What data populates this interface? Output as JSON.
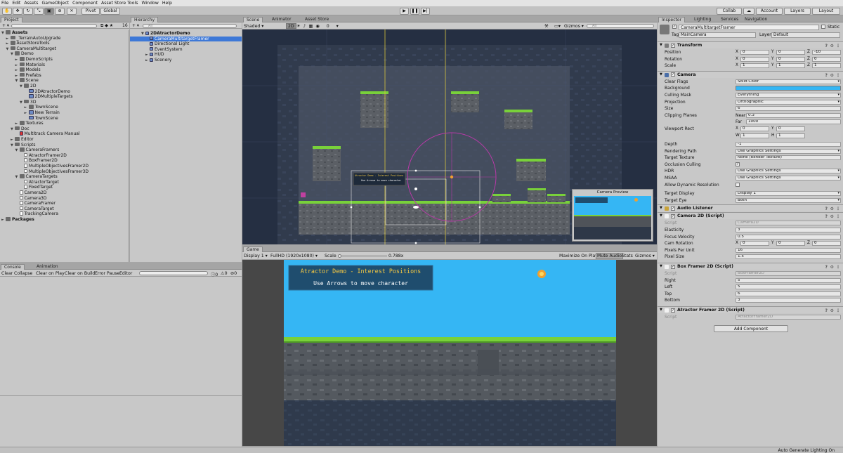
{
  "menu": [
    "File",
    "Edit",
    "Assets",
    "GameObject",
    "Component",
    "Asset Store Tools",
    "Window",
    "Help"
  ],
  "toolbar": {
    "pivot": "Pivot",
    "global": "Global",
    "collab": "Collab",
    "account": "Account",
    "layers": "Layers",
    "layout": "Layout"
  },
  "project": {
    "tabs": [
      "Project"
    ],
    "count": "16",
    "tree": [
      {
        "label": "Assets",
        "indent": 0,
        "arrow": "▼",
        "icon": "folder",
        "bold": true
      },
      {
        "label": "_TerrainAutoUpgrade",
        "indent": 1,
        "arrow": "►",
        "icon": "folder"
      },
      {
        "label": "AssetStoreTools",
        "indent": 1,
        "arrow": "►",
        "icon": "folder"
      },
      {
        "label": "CameraMultitarget",
        "indent": 1,
        "arrow": "▼",
        "icon": "folder"
      },
      {
        "label": "Demo",
        "indent": 2,
        "arrow": "▼",
        "icon": "folder"
      },
      {
        "label": "DemoScripts",
        "indent": 3,
        "arrow": "►",
        "icon": "folder"
      },
      {
        "label": "Materials",
        "indent": 3,
        "arrow": "►",
        "icon": "folder"
      },
      {
        "label": "Models",
        "indent": 3,
        "arrow": "►",
        "icon": "folder"
      },
      {
        "label": "Prefabs",
        "indent": 3,
        "arrow": "►",
        "icon": "folder"
      },
      {
        "label": "Scene",
        "indent": 3,
        "arrow": "▼",
        "icon": "folder"
      },
      {
        "label": "2D",
        "indent": 4,
        "arrow": "▼",
        "icon": "folder"
      },
      {
        "label": "2DAtractorDemo",
        "indent": 5,
        "arrow": "",
        "icon": "gameobj"
      },
      {
        "label": "2DMultipleTargets",
        "indent": 5,
        "arrow": "",
        "icon": "gameobj"
      },
      {
        "label": "3D",
        "indent": 4,
        "arrow": "▼",
        "icon": "folder"
      },
      {
        "label": "TownScene",
        "indent": 5,
        "arrow": "►",
        "icon": "folder"
      },
      {
        "label": "New Terrain",
        "indent": 5,
        "arrow": "►",
        "icon": "gameobj"
      },
      {
        "label": "TownScene",
        "indent": 5,
        "arrow": "",
        "icon": "gameobj"
      },
      {
        "label": "Textures",
        "indent": 3,
        "arrow": "►",
        "icon": "folder"
      },
      {
        "label": "Doc",
        "indent": 2,
        "arrow": "▼",
        "icon": "folder"
      },
      {
        "label": "Multitrack Camera Manual",
        "indent": 3,
        "arrow": "",
        "icon": "pdf"
      },
      {
        "label": "Editor",
        "indent": 2,
        "arrow": "►",
        "icon": "folder"
      },
      {
        "label": "Scripts",
        "indent": 2,
        "arrow": "▼",
        "icon": "folder"
      },
      {
        "label": "CameraFramers",
        "indent": 3,
        "arrow": "▼",
        "icon": "folder"
      },
      {
        "label": "AtractorFramer2D",
        "indent": 4,
        "arrow": "",
        "icon": "script"
      },
      {
        "label": "BoxFramer2D",
        "indent": 4,
        "arrow": "",
        "icon": "script"
      },
      {
        "label": "MultipleObjectivesFramer2D",
        "indent": 4,
        "arrow": "",
        "icon": "script"
      },
      {
        "label": "MultipleObjectivesFramer3D",
        "indent": 4,
        "arrow": "",
        "icon": "script"
      },
      {
        "label": "CameraTargets",
        "indent": 3,
        "arrow": "▼",
        "icon": "folder"
      },
      {
        "label": "AtractorTarget",
        "indent": 4,
        "arrow": "",
        "icon": "script"
      },
      {
        "label": "FixedTarget",
        "indent": 4,
        "arrow": "",
        "icon": "script"
      },
      {
        "label": "Camera2D",
        "indent": 3,
        "arrow": "",
        "icon": "script"
      },
      {
        "label": "Camera3D",
        "indent": 3,
        "arrow": "",
        "icon": "script"
      },
      {
        "label": "CameraFramer",
        "indent": 3,
        "arrow": "",
        "icon": "script"
      },
      {
        "label": "CameraTarget",
        "indent": 3,
        "arrow": "",
        "icon": "script"
      },
      {
        "label": "TrackingCamera",
        "indent": 3,
        "arrow": "",
        "icon": "script"
      },
      {
        "label": "Packages",
        "indent": 0,
        "arrow": "►",
        "icon": "folder",
        "bold": true
      }
    ]
  },
  "hierarchy": {
    "tab": "Hierarchy",
    "search": "All",
    "tree": [
      {
        "label": "2DAtractorDemo",
        "indent": 0,
        "arrow": "▼",
        "bold": true
      },
      {
        "label": "CameraMultitargetFramer",
        "indent": 1,
        "arrow": "",
        "selected": true
      },
      {
        "label": "Directional Light",
        "indent": 1,
        "arrow": ""
      },
      {
        "label": "EventSystem",
        "indent": 1,
        "arrow": ""
      },
      {
        "label": "HUD",
        "indent": 1,
        "arrow": "►"
      },
      {
        "label": "Scenery",
        "indent": 1,
        "arrow": "►"
      }
    ]
  },
  "console": {
    "tabs": [
      "Console",
      "Animation"
    ],
    "buttons": [
      "Clear",
      "Collapse",
      "Clear on Play",
      "Clear on Build",
      "Error Pause",
      "Editor"
    ],
    "counts": [
      "0",
      "0",
      "0"
    ]
  },
  "scene": {
    "tabs": [
      "Scene",
      "Animator",
      "Asset Store"
    ],
    "shading": "Shaded",
    "mode2d": "2D",
    "gizmos": "Gizmos",
    "search": "All",
    "hud_title": "Atractor Demo - Interest Positions",
    "hud_sub": "Use Arrows to move character",
    "preview_title": "Camera Preview"
  },
  "game": {
    "tab": "Game",
    "display": "Display 1",
    "resolution": "FullHD (1920x1080)",
    "scale_label": "Scale",
    "scale_value": "0.788x",
    "maximize": "Maximize On Play",
    "mute": "Mute Audio",
    "stats": "Stats",
    "gizmos": "Gizmos",
    "hud_title": "Atractor Demo - Interest Positions",
    "hud_sub": "Use Arrows to move character"
  },
  "inspector": {
    "tabs": [
      "Inspector",
      "Lighting",
      "Services",
      "Navigation"
    ],
    "object_name": "CameraMultitargetFramer",
    "static": "Static",
    "tag_label": "Tag",
    "tag": "MainCamera",
    "layer_label": "Layer",
    "layer": "Default",
    "transform": {
      "title": "Transform",
      "rows": [
        {
          "label": "Position",
          "x": "0",
          "y": "0",
          "z": "-10"
        },
        {
          "label": "Rotation",
          "x": "0",
          "y": "0",
          "z": "0"
        },
        {
          "label": "Scale",
          "x": "1",
          "y": "1",
          "z": "1"
        }
      ]
    },
    "camera": {
      "title": "Camera",
      "clear_flags": [
        "Clear Flags",
        "Solid Color"
      ],
      "background": "Background",
      "culling_mask": [
        "Culling Mask",
        "Everything"
      ],
      "projection": [
        "Projection",
        "Orthographic"
      ],
      "size": [
        "Size",
        "6"
      ],
      "clipping": "Clipping Planes",
      "near_label": "Near",
      "near": "0.3",
      "far_label": "Far",
      "far": "1000",
      "viewport": "Viewport Rect",
      "vx": "0",
      "vy": "0",
      "vw": "1",
      "vh": "1",
      "depth": [
        "Depth",
        "-1"
      ],
      "rendering_path": [
        "Rendering Path",
        "Use Graphics Settings"
      ],
      "target_texture": [
        "Target Texture",
        "None (Render Texture)"
      ],
      "occlusion": "Occlusion Culling",
      "hdr": [
        "HDR",
        "Use Graphics Settings"
      ],
      "msaa": [
        "MSAA",
        "Use Graphics Settings"
      ],
      "dynres": "Allow Dynamic Resolution",
      "target_display": [
        "Target Display",
        "Display 1"
      ],
      "target_eye": [
        "Target Eye",
        "Both"
      ]
    },
    "audio": {
      "title": "Audio Listener"
    },
    "camera2d": {
      "title": "Camera 2D (Script)",
      "script": [
        "Script",
        "Camera2D"
      ],
      "elasticity": [
        "Elasticity",
        "3"
      ],
      "focus": [
        "Focus Velocity",
        "0.5"
      ],
      "camrot": "Cam Rotation",
      "rx": "0",
      "ry": "0",
      "rz": "0",
      "ppu": [
        "Pixels Per Unit",
        "16"
      ],
      "pixsize": [
        "Pixel Size",
        "1.5"
      ]
    },
    "boxframer": {
      "title": "Box Framer 2D (Script)",
      "script": [
        "Script",
        "BoxFramer2D"
      ],
      "right": [
        "Right",
        "5"
      ],
      "left": [
        "Left",
        "5"
      ],
      "top": [
        "Top",
        "6"
      ],
      "bottom": [
        "Bottom",
        "3"
      ]
    },
    "atractor": {
      "title": "Atractor Framer 2D (Script)",
      "script": [
        "Script",
        "AtractorFramer2D"
      ]
    },
    "add_component": "Add Component"
  },
  "status": "Auto Generate Lighting On",
  "colors": {
    "sky": "#35b6f4",
    "grass": "#79d13a",
    "selection": "#3d78d7",
    "hud_bg": "#1f4d6e",
    "hud_title": "#f5c842"
  }
}
